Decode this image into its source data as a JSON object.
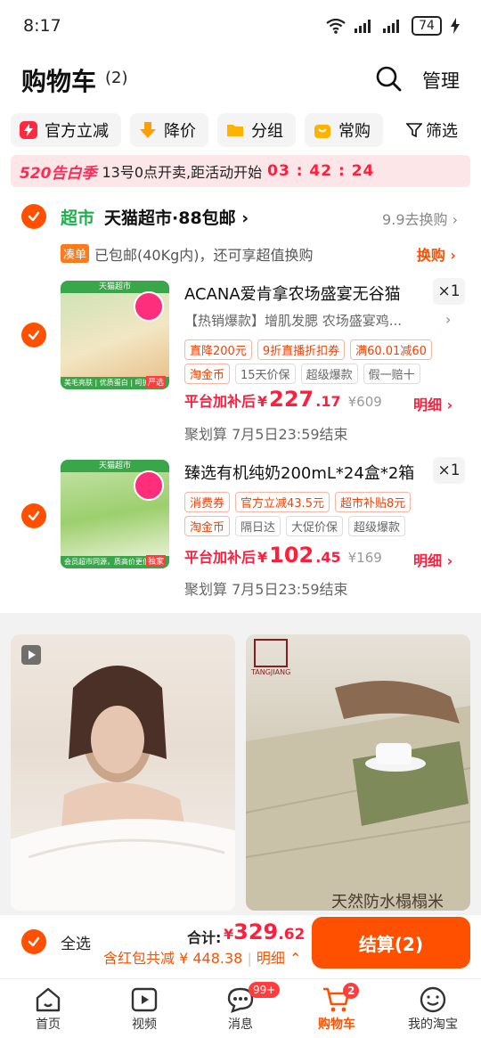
{
  "status_bar": {
    "time": "8:17",
    "battery": "74"
  },
  "header": {
    "title": "购物车",
    "count": "(2)",
    "manage_label": "管理"
  },
  "chips": [
    {
      "label": "官方立减",
      "icon": "lightning-icon"
    },
    {
      "label": "降价",
      "icon": "arrow-down-icon"
    },
    {
      "label": "分组",
      "icon": "folder-icon"
    },
    {
      "label": "常购",
      "icon": "bag-icon"
    }
  ],
  "filter_label": "筛选",
  "promo": {
    "tag": "520告白季",
    "text": "13号0点开卖,距活动开始",
    "countdown": "03 : 42 : 24"
  },
  "store": {
    "badge": "超市",
    "name": "天猫超市·88包邮",
    "exchange_label": "9.9去换购",
    "notice_tag": "凑单",
    "notice_text": "已包邮(40Kg内)，还可享超值换购",
    "notice_link": "换购"
  },
  "products": [
    {
      "title": "ACANA爱肯拿农场盛宴无谷猫",
      "subtitle": "【热销爆款】增肌发腮 农场盛宴鸡...",
      "qty": "×1",
      "tags_promo": [
        "直降200元",
        "9折直播折扣券",
        "满60.01减60"
      ],
      "tags_service": [
        "淘金币",
        "15天价保",
        "超级爆款",
        "假一赔十"
      ],
      "price_label": "平台加补后",
      "price_currency": "¥",
      "price_int": "227",
      "price_dec": ".17",
      "price_orig": "¥609",
      "detail_label": "明细",
      "deadline": "聚划算 7月5日23:59结束",
      "thumb_band": "天猫超市",
      "thumb_foot": "美毛亮肤 | 优质蛋白 | 呵护心脏",
      "thumb_corner": "严选"
    },
    {
      "title": "臻选有机纯奶200mL*24盒*2箱",
      "subtitle": "",
      "qty": "×1",
      "tags_promo": [
        "消费券",
        "官方立减43.5元",
        "超市补贴8元"
      ],
      "tags_service": [
        "淘金币",
        "隔日达",
        "大促价保",
        "超级爆款"
      ],
      "price_label": "平台加补后",
      "price_currency": "¥",
      "price_int": "102",
      "price_dec": ".45",
      "price_orig": "¥169",
      "detail_label": "明细",
      "deadline": "聚划算 7月5日23:59结束",
      "thumb_band": "天猫超市",
      "thumb_foot": "会员超市同源，质高价更低",
      "thumb_corner": "独家"
    }
  ],
  "recommendations": [
    {
      "watermark": ""
    },
    {
      "brand": "TANGJIANG",
      "watermark": "天然防水榻榻米"
    }
  ],
  "summary": {
    "select_all_label": "全选",
    "total_label": "合计:",
    "total_currency": "¥",
    "total_int": "329",
    "total_dec": ".62",
    "coupon_text": "含红包共减 ¥ 448.38",
    "coupon_detail": "明细",
    "checkout_label": "结算(2)"
  },
  "tabbar": [
    {
      "label": "首页",
      "icon": "home-icon",
      "badge": ""
    },
    {
      "label": "视频",
      "icon": "video-icon",
      "badge": ""
    },
    {
      "label": "消息",
      "icon": "message-icon",
      "badge": "99+"
    },
    {
      "label": "购物车",
      "icon": "cart-icon",
      "badge": "2",
      "active": true
    },
    {
      "label": "我的淘宝",
      "icon": "profile-icon",
      "badge": ""
    }
  ],
  "colors": {
    "accent": "#ff5000",
    "price_red": "#ff1e3c",
    "store_green": "#18b34a"
  }
}
